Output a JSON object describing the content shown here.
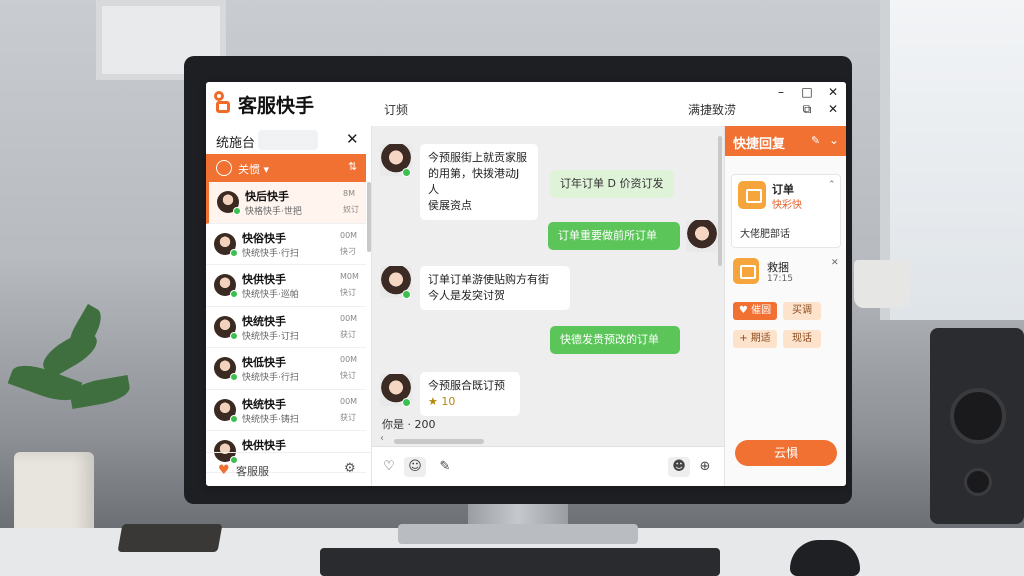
{
  "app": {
    "title": "客服快手",
    "header_tab": "订频",
    "header_right": "满捷致涝",
    "controls": {
      "minimize": "–",
      "maximize": "□",
      "close": "✕",
      "restore": "⧉",
      "close2": "✕"
    }
  },
  "sidebar": {
    "search_label": "统施台",
    "search_placeholder": "",
    "filter_label": "关惯 ▾",
    "filter_sort": "⇅",
    "conversations": [
      {
        "name": "快后快手",
        "preview": "快格快手·世把",
        "time": "8M",
        "status": "奴订"
      },
      {
        "name": "快俗快手",
        "preview": "快统快手·行扫",
        "time": "00M",
        "status": "快刁"
      },
      {
        "name": "快供快手",
        "preview": "快统快手·巡帕",
        "time": "M0M",
        "status": "快订"
      },
      {
        "name": "快统快手",
        "preview": "快统快手·订扫",
        "time": "00M",
        "status": "获订"
      },
      {
        "name": "快低快手",
        "preview": "快统快手·行扫",
        "time": "00M",
        "status": "快订"
      },
      {
        "name": "快统快手",
        "preview": "快统快手·铸扫",
        "time": "00M",
        "status": "获订"
      },
      {
        "name": "快供快手",
        "preview": "",
        "time": "",
        "status": ""
      }
    ],
    "footer_label": "客服服",
    "footer_icon": "⚙"
  },
  "chat": {
    "messages": [
      {
        "dir": "in",
        "lines": [
          "今预服街上就贡家服",
          "的用第，快拨港动J人",
          "侯展资点"
        ]
      },
      {
        "dir": "out-soft",
        "lines": [
          "订年订单 D 价资订发"
        ]
      },
      {
        "dir": "out",
        "lines": [
          "订单重要做前所订单"
        ]
      },
      {
        "dir": "in",
        "lines": [
          "订单订单游使贴购方有街",
          "今人是发突讨贺"
        ]
      },
      {
        "dir": "out",
        "lines": [
          "快德发贵预改的订单"
        ]
      },
      {
        "dir": "in",
        "lines": [
          "今预服合既订预",
          "★ 10"
        ]
      }
    ],
    "status_text": "你是 · 200",
    "toolbar": [
      "♡",
      "☺",
      "✎",
      "☻",
      "⊕"
    ]
  },
  "quick_reply": {
    "title": "快捷回复",
    "edit": "✎",
    "collapse": "⌄",
    "card1": {
      "title": "订单",
      "subtitle": "快彩快",
      "chevron": "⌃",
      "detail": "大佬肥部话"
    },
    "card2": {
      "title": "救捆",
      "subtitle": "17:15",
      "close": "✕"
    },
    "chips": [
      "♥ 催圆",
      "买调",
      "+ 期适",
      "现话"
    ],
    "send_label": "云惧"
  },
  "colors": {
    "accent": "#f07132",
    "online": "#3bbf4e",
    "bubble_out": "#5cc55a"
  }
}
